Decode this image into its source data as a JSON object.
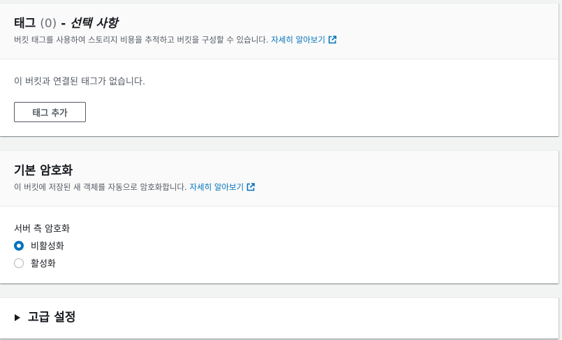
{
  "tags": {
    "title": "태그",
    "count": "(0)",
    "dash": "-",
    "optional": "선택 사항",
    "description": "버킷 태그를 사용하여 스토리지 비용을 추적하고 버킷을 구성할 수 있습니다.",
    "learn_more": "자세히 알아보기",
    "empty_text": "이 버킷과 연결된 태그가 없습니다.",
    "add_button": "태그 추가"
  },
  "encryption": {
    "title": "기본 암호화",
    "description": "이 버킷에 저장된 새 객체를 자동으로 암호화합니다.",
    "learn_more": "자세히 알아보기",
    "field_label": "서버 측 암호화",
    "options": [
      {
        "label": "비활성화",
        "selected": true
      },
      {
        "label": "활성화",
        "selected": false
      }
    ]
  },
  "advanced": {
    "title": "고급 설정"
  },
  "colors": {
    "link": "#0073bb",
    "radio_selected": "#0073bb"
  }
}
